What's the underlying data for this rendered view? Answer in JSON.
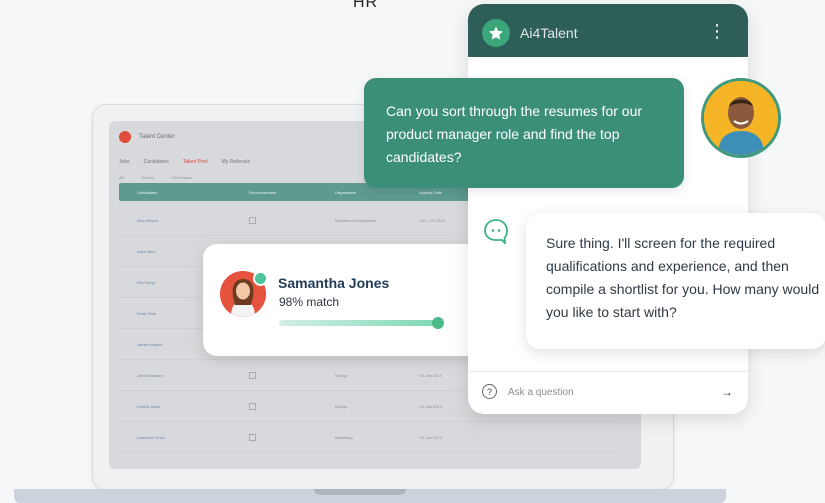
{
  "top_fragment": "HR",
  "talent_app": {
    "title": "Talent Center",
    "tabs": [
      "Jobs",
      "Candidates",
      "Talent Pool",
      "My Referrals"
    ],
    "filters": [
      "All",
      "Sort by",
      "First Name"
    ],
    "columns": [
      "Candidates",
      "Recommended",
      "Department",
      "Applied Date"
    ],
    "rows": [
      {
        "name": "Alex Wilson",
        "department": "Business Development",
        "date": "XXX, XX 2019"
      },
      {
        "name": "Arjun Bani",
        "department": "",
        "date": ""
      },
      {
        "name": "Elle Flung",
        "department": "",
        "date": ""
      },
      {
        "name": "Emily Park",
        "department": "",
        "date": ""
      },
      {
        "name": "James Waters",
        "department": "",
        "date": ""
      },
      {
        "name": "John Abraham",
        "department": "Design",
        "date": "XX Jan 2019"
      },
      {
        "name": "Karthik Iswar",
        "department": "Design",
        "date": "XX Jan 2019"
      },
      {
        "name": "Lawrence Chen",
        "department": "Marketing",
        "date": "XX Jan 2019"
      }
    ]
  },
  "candidate_card": {
    "name": "Samantha Jones",
    "match": "98% match",
    "match_value": 0.98,
    "online_color": "#4fc39a"
  },
  "chat": {
    "title": "Ai4Talent",
    "menu_icon": "kebab-menu-icon",
    "header_color": "#2e5e58",
    "user_message": "Can you sort through the resumes for our product manager role and find the top candidates?",
    "bot_message": "Sure thing. I'll screen for the required qualifications and experience, and then compile a shortlist for you. How many would you like to start with?",
    "input_placeholder": "Ask a question",
    "help_icon": "question-circle-icon",
    "send_icon": "arrow-right-icon",
    "accent_color": "#3b8f79"
  }
}
